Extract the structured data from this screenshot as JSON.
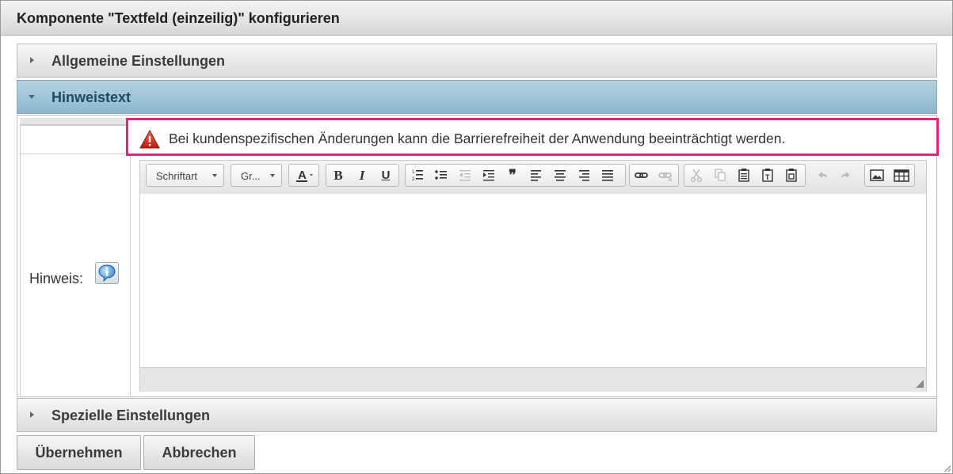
{
  "dialog": {
    "title": "Komponente \"Textfeld (einzeilig)\" konfigurieren"
  },
  "sections": {
    "allgemein": "Allgemeine Einstellungen",
    "hinweistext": "Hinweistext",
    "speziell": "Spezielle Einstellungen"
  },
  "warning": {
    "text": "Bei kundenspezifischen Änderungen kann die Barrierefreiheit der Anwendung beeinträchtigt werden.",
    "color": "#e8217a"
  },
  "field": {
    "label": "Hinweis:"
  },
  "editor": {
    "font_combo": "Schriftart",
    "size_combo": "Gr...",
    "buttons": {
      "bold": "B",
      "italic": "I",
      "underline": "U",
      "blockquote": "❞"
    }
  },
  "actions": {
    "apply": "Übernehmen",
    "cancel": "Abbrechen"
  }
}
